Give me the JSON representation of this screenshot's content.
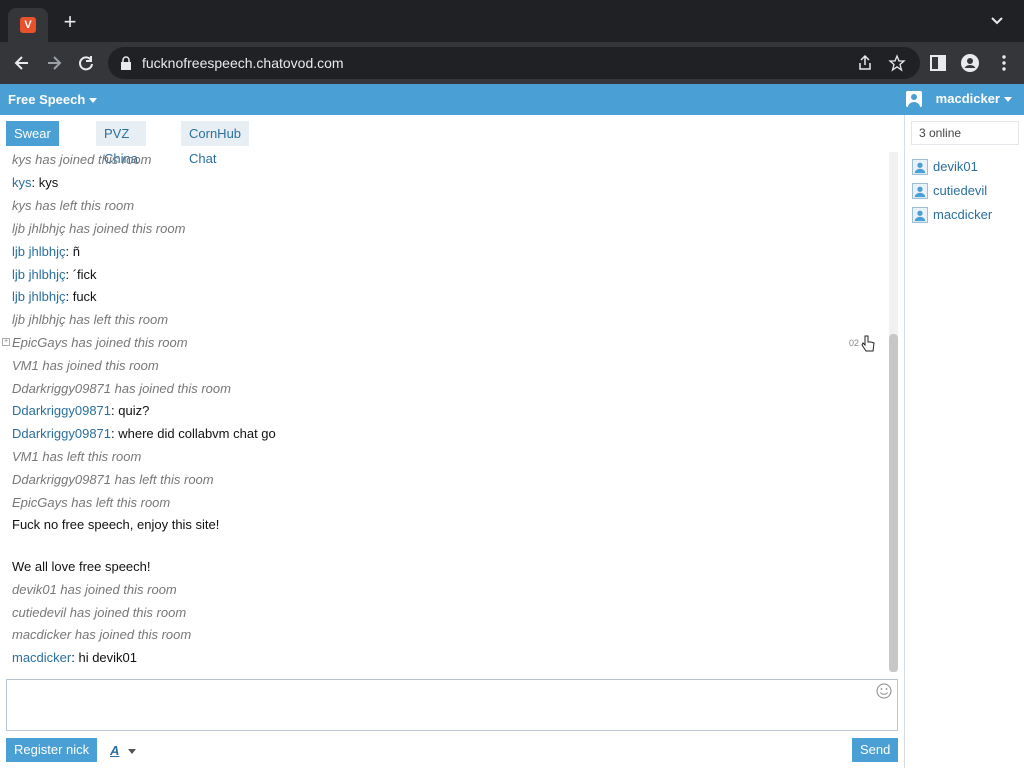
{
  "browser": {
    "favicon_letter": "V",
    "url": "fucknofreespeech.chatovod.com"
  },
  "app": {
    "room_title": "Free Speech",
    "current_user": "macdicker"
  },
  "room_tabs": [
    {
      "label": "Swear Chat",
      "active": true
    },
    {
      "label": "PVZ China",
      "active": false
    },
    {
      "label": "CornHub Chat",
      "active": false
    }
  ],
  "messages": [
    {
      "type": "system",
      "text": "kys has joined this room"
    },
    {
      "type": "chat",
      "nick": "kys",
      "text": ": kys"
    },
    {
      "type": "system",
      "text": "kys has left this room"
    },
    {
      "type": "system",
      "text": "ljb jhlbhjç has joined this room"
    },
    {
      "type": "chat",
      "nick": "ljb jhlbhjç",
      "text": ": ñ"
    },
    {
      "type": "chat",
      "nick": "ljb jhlbhjç",
      "text": ": ´fick"
    },
    {
      "type": "chat",
      "nick": "ljb jhlbhjç",
      "text": ": fuck"
    },
    {
      "type": "system",
      "text": "ljb jhlbhjç has left this room"
    },
    {
      "type": "system",
      "text": "EpicGays has joined this room"
    },
    {
      "type": "system",
      "text": "VM1 has joined this room"
    },
    {
      "type": "system",
      "text": "Ddarkriggy09871 has joined this room"
    },
    {
      "type": "chat",
      "nick": "Ddarkriggy09871",
      "text": ": quiz?"
    },
    {
      "type": "chat",
      "nick": "Ddarkriggy09871",
      "text": ": where did collabvm chat go"
    },
    {
      "type": "system",
      "text": "VM1 has left this room"
    },
    {
      "type": "system",
      "text": "Ddarkriggy09871 has left this room"
    },
    {
      "type": "system",
      "text": "EpicGays has left this room"
    },
    {
      "type": "plain",
      "text": "Fuck no free speech, enjoy this site!"
    },
    {
      "type": "plain",
      "text": "We all love free speech!"
    },
    {
      "type": "system",
      "text": "devik01 has joined this room"
    },
    {
      "type": "system",
      "text": "cutiedevil has joined this room"
    },
    {
      "type": "system",
      "text": "macdicker has joined this room"
    },
    {
      "type": "chat",
      "nick": "macdicker",
      "text": ": hi devik01"
    }
  ],
  "hover_time": "02",
  "composer": {
    "register_label": "Register nick",
    "font_label": "A",
    "send_label": "Send"
  },
  "sidebar": {
    "online_count": "3 online",
    "users": [
      "devik01",
      "cutiedevil",
      "macdicker"
    ]
  },
  "icons": {
    "tab": "favicon-icon",
    "new_tab": "plus-icon",
    "back": "back-arrow-icon",
    "forward": "forward-arrow-icon",
    "reload": "reload-icon",
    "lock": "lock-icon",
    "share": "share-icon",
    "star": "star-icon",
    "sidepanel": "side-panel-icon",
    "profile": "profile-icon",
    "menu": "kebab-menu-icon",
    "smiley": "smiley-icon",
    "user": "user-icon"
  }
}
